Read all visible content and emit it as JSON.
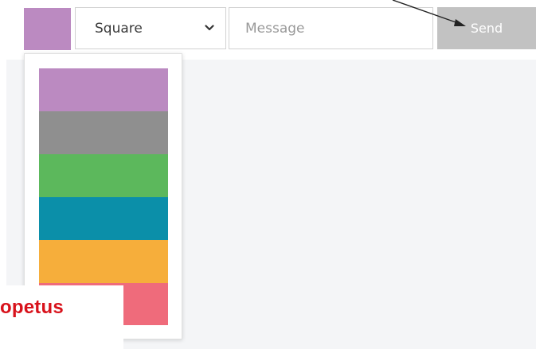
{
  "toolbar": {
    "color_swatch": {
      "color": "#bb8ac1"
    },
    "shape_select": {
      "selected": "Square",
      "icon": "chevron-down-icon"
    },
    "message_input": {
      "value": "",
      "placeholder": "Message"
    },
    "send_button": {
      "label": "Send"
    }
  },
  "color_dropdown": {
    "options": [
      {
        "color": "#bb8ac1"
      },
      {
        "color": "#8f8f8f"
      },
      {
        "color": "#5cb85c"
      },
      {
        "color": "#0b8fa9"
      },
      {
        "color": "#f6ae3b"
      },
      {
        "color": "#ef6b7b"
      }
    ]
  },
  "logo": {
    "text": "opetus"
  },
  "colors": {
    "canvas_background": "#f4f5f7",
    "send_button_background": "#c2c2c2",
    "logo_text": "#d8121b"
  }
}
